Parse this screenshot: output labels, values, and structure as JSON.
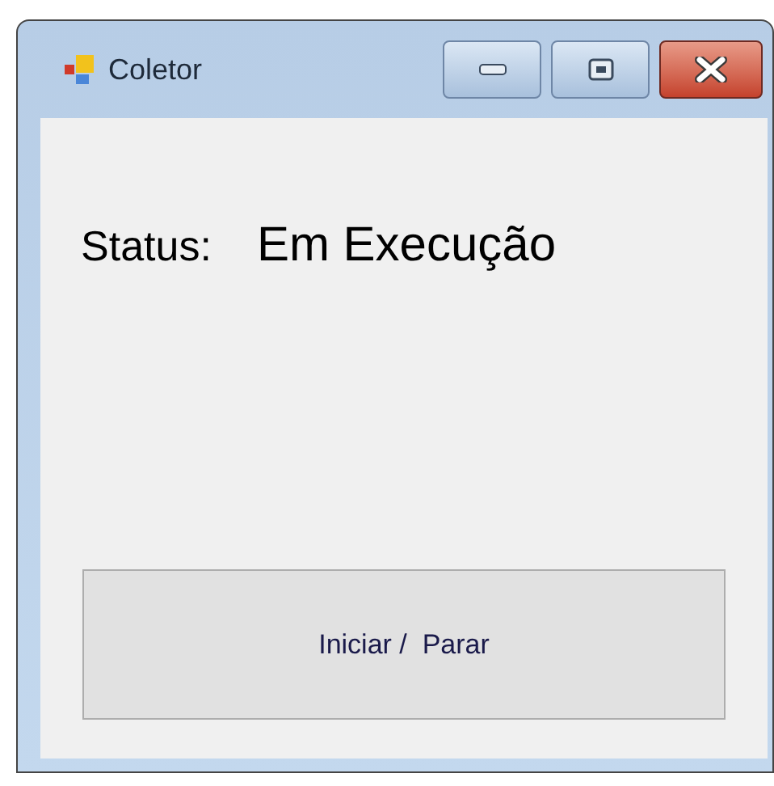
{
  "window": {
    "title": "Coletor"
  },
  "status": {
    "label": "Status:",
    "value": "Em Execução"
  },
  "buttons": [
    {
      "label": "Iniciar /  Parar"
    }
  ]
}
